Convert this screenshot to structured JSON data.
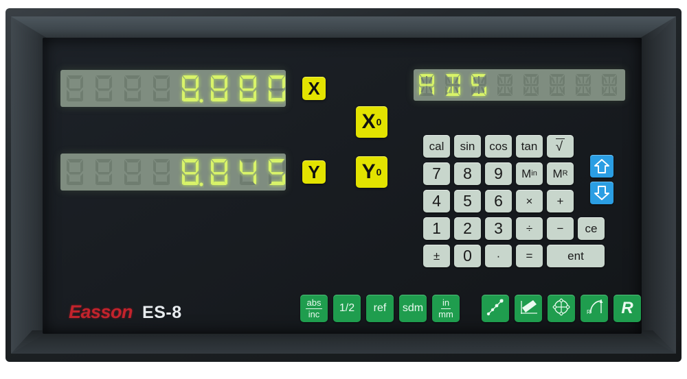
{
  "device": {
    "brand": "Easson",
    "model": "ES-8",
    "type": "2-axis digital readout (DRO) control panel"
  },
  "displays": {
    "x_axis": {
      "label": "X",
      "value": "8.880",
      "digits": [
        "",
        "",
        "",
        "",
        "8.",
        "8",
        "8",
        "0"
      ],
      "total_cells": 8,
      "lit_from": 4,
      "color": "#d9f36a"
    },
    "y_axis": {
      "label": "Y",
      "value": "8.845",
      "digits": [
        "",
        "",
        "",
        "",
        "8.",
        "8",
        "4",
        "5"
      ],
      "total_cells": 8,
      "lit_from": 4,
      "color": "#d9f36a"
    },
    "status": {
      "value": "ABS",
      "chars": [
        "A",
        "B",
        "S",
        "",
        "",
        "",
        "",
        ""
      ],
      "total_cells": 8,
      "lit_count": 3,
      "color": "#d9f36a"
    }
  },
  "axis_keys": [
    {
      "name": "x-label",
      "label": "X",
      "sub": "",
      "color": "#e3e300"
    },
    {
      "name": "y-label",
      "label": "Y",
      "sub": "",
      "color": "#e3e300"
    },
    {
      "name": "x-zero",
      "label": "X",
      "sub": "0",
      "color": "#e3e300"
    },
    {
      "name": "y-zero",
      "label": "Y",
      "sub": "0",
      "color": "#e3e300"
    }
  ],
  "keypad": {
    "rows": [
      [
        {
          "label": "cal",
          "name": "cal"
        },
        {
          "label": "sin",
          "name": "sin"
        },
        {
          "label": "cos",
          "name": "cos"
        },
        {
          "label": "tan",
          "name": "tan"
        },
        {
          "label": "√",
          "name": "sqrt"
        }
      ],
      [
        {
          "label": "7",
          "name": "7"
        },
        {
          "label": "8",
          "name": "8"
        },
        {
          "label": "9",
          "name": "9"
        },
        {
          "label": "M",
          "sub": "in",
          "name": "memory-in"
        },
        {
          "label": "M",
          "sub": "R",
          "name": "memory-recall"
        }
      ],
      [
        {
          "label": "4",
          "name": "4"
        },
        {
          "label": "5",
          "name": "5"
        },
        {
          "label": "6",
          "name": "6"
        },
        {
          "label": "×",
          "name": "multiply"
        },
        {
          "label": "+",
          "name": "plus"
        }
      ],
      [
        {
          "label": "1",
          "name": "1"
        },
        {
          "label": "2",
          "name": "2"
        },
        {
          "label": "3",
          "name": "3"
        },
        {
          "label": "÷",
          "name": "divide"
        },
        {
          "label": "−",
          "name": "minus"
        },
        {
          "label": "ce",
          "name": "clear-entry"
        }
      ],
      [
        {
          "label": "±",
          "name": "plus-minus"
        },
        {
          "label": "0",
          "name": "0"
        },
        {
          "label": "·",
          "name": "decimal-point"
        },
        {
          "label": "=",
          "name": "equals"
        },
        {
          "label": "ent",
          "name": "enter"
        }
      ]
    ]
  },
  "nav_keys": [
    {
      "name": "up-arrow",
      "icon": "arrow-up-icon",
      "color": "#2b9ee3"
    },
    {
      "name": "down-arrow",
      "icon": "arrow-down-icon",
      "color": "#2b9ee3"
    }
  ],
  "function_keys": [
    {
      "name": "abs-inc",
      "top": "abs",
      "bottom": "inc"
    },
    {
      "name": "half",
      "label": "1/2"
    },
    {
      "name": "ref",
      "label": "ref"
    },
    {
      "name": "sdm",
      "label": "sdm"
    },
    {
      "name": "in-mm",
      "top": "in",
      "bottom": "mm"
    }
  ],
  "graphic_keys": [
    {
      "name": "linear-hole-pattern",
      "icon": "line-of-holes-icon"
    },
    {
      "name": "slant-machining",
      "icon": "tilted-plate-icon"
    },
    {
      "name": "bolt-hole-circle",
      "icon": "circle-of-holes-icon"
    },
    {
      "name": "arc-radius",
      "icon": "arc-radius-icon"
    },
    {
      "name": "radius-r",
      "label": "R"
    }
  ],
  "colors": {
    "led_on": "#d9f36a",
    "led_off": "#6f7d70",
    "display_bg": "#7f8d80",
    "yellow_key": "#e3e300",
    "green_key": "#1f9d4e",
    "blue_key": "#2b9ee3",
    "keypad_key": "#c8d6cc",
    "brand_red": "#c3232c",
    "case_dark": "#1b1f22"
  }
}
